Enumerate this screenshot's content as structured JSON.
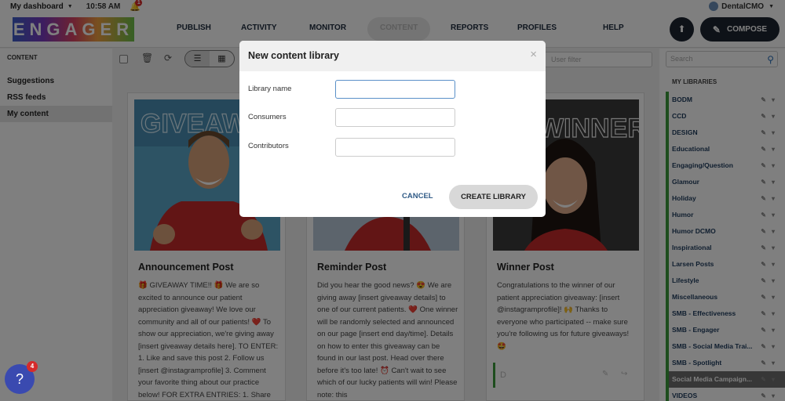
{
  "topbar": {
    "dashboard": "My dashboard",
    "time": "10:58 AM",
    "notif_count": "1",
    "user": "DentalCMO"
  },
  "logo": {
    "text": "ENGAGER"
  },
  "nav": {
    "items": [
      "PUBLISH",
      "ACTIVITY",
      "MONITOR",
      "CONTENT",
      "REPORTS",
      "PROFILES",
      "HELP"
    ],
    "compose": "COMPOSE"
  },
  "leftbar": {
    "section": "CONTENT",
    "items": [
      "Suggestions",
      "RSS feeds",
      "My content"
    ]
  },
  "toolbar": {
    "user_filter": "User filter"
  },
  "rightbar": {
    "search_placeholder": "Search",
    "section": "MY LIBRARIES",
    "libraries": [
      "BODM",
      "CCD",
      "DESIGN",
      "Educational",
      "Engaging/Question",
      "Glamour",
      "Holiday",
      "Humor",
      "Humor DCMO",
      "Inspirational",
      "Larsen Posts",
      "Lifestyle",
      "Miscellaneous",
      "SMB - Effectiveness",
      "SMB - Engager",
      "SMB - Social Media Trai...",
      "SMB - Spotlight",
      "Social Media Campaign...",
      "VIDEOS"
    ]
  },
  "cards": [
    {
      "overlay_text": "GIVEAWAY",
      "title": "Announcement Post",
      "body": "🎁 GIVEAWAY TIME!! 🎁 We are so excited to announce our patient appreciation giveaway! We love our community and all of our patients! ❤️ To show our appreciation, we're giving away [insert giveaway details here]. TO ENTER: 1. Like and save this post 2. Follow us [insert @instagramprofile] 3. Comment your favorite thing about our practice below! FOR EXTRA ENTRIES: 1. Share this"
    },
    {
      "overlay_text": "",
      "title": "Reminder Post",
      "body": "Did you hear the good news? 😍 We are giving away [insert giveaway details] to one of our current patients. ❤️ One winner will be randomly selected and announced on our page [insert end day/time]. Details on how to enter this giveaway can be found in our last post. Head over there before it's too late! ⏰ Can't wait to see which of our lucky patients will win! Please note: this"
    },
    {
      "overlay_text": "WINNER",
      "title": "Winner Post",
      "body": "Congratulations to the winner of our patient appreciation giveaway: [insert @instagramprofile]! 🙌 Thanks to everyone who participated -- make sure you're following us for future giveaways! 🤩"
    }
  ],
  "comment_placeholder": "D",
  "modal": {
    "title": "New content library",
    "close": "×",
    "fields": [
      "Library name",
      "Consumers",
      "Contributors"
    ],
    "cancel": "CANCEL",
    "create": "CREATE LIBRARY"
  },
  "help_badge": "4",
  "colors": {
    "accent": "#1d2430",
    "library_bar": "#3a9a3a",
    "link": "#2f5a86",
    "badge": "#d62b2b"
  }
}
